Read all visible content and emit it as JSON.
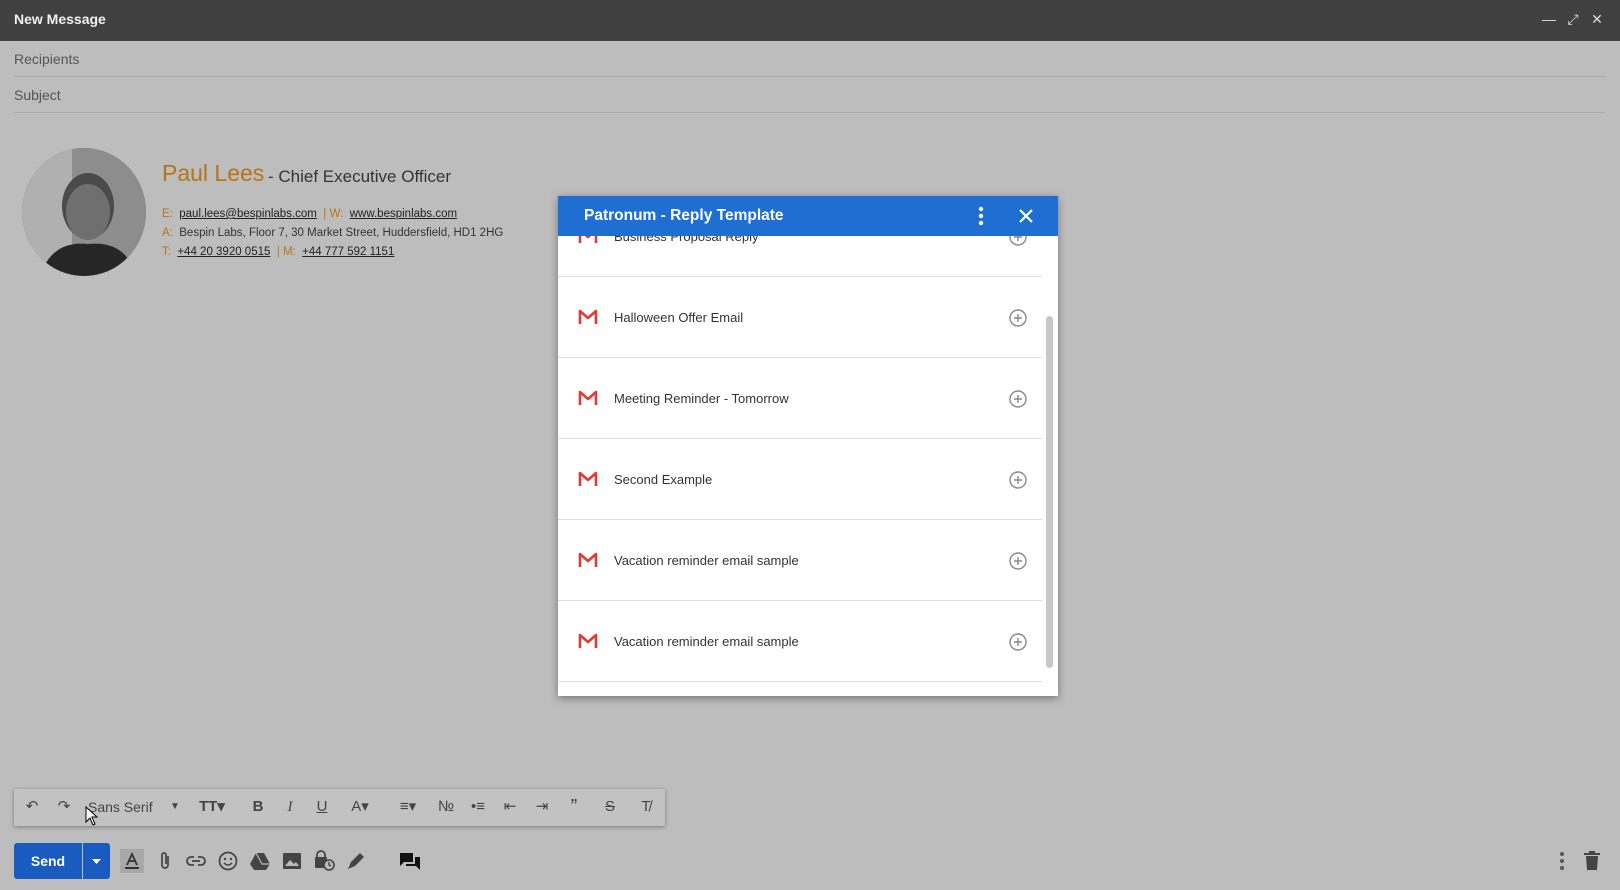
{
  "window": {
    "title": "New Message"
  },
  "compose": {
    "recipients_placeholder": "Recipients",
    "subject_placeholder": "Subject"
  },
  "signature": {
    "name": "Paul Lees",
    "role": "- Chief Executive Officer",
    "email_label": "E:",
    "email": "paul.lees@bespinlabs.com",
    "web_label": "| W:",
    "web": "www.bespinlabs.com",
    "address_label": "A:",
    "address": "Bespin Labs, Floor 7, 30 Market Street, Huddersfield, HD1 2HG",
    "tel_label": "T:",
    "tel": "+44 20 3920 0515",
    "mobile_label": "| M:",
    "mobile": "+44 777 592 1151"
  },
  "dialog": {
    "title": "Patronum - Reply Template",
    "templates": [
      "Business Proposal Reply",
      "Halloween Offer Email",
      "Meeting Reminder - Tomorrow",
      "Second Example",
      "Vacation reminder email sample",
      "Vacation reminder email sample"
    ]
  },
  "toolbar": {
    "font": "Sans Serif"
  },
  "actions": {
    "send_label": "Send"
  },
  "colors": {
    "accent": "#1f6ed4",
    "send": "#1a5bbf",
    "signature_orange": "#b8741a",
    "gmail_red": "#e53935"
  }
}
